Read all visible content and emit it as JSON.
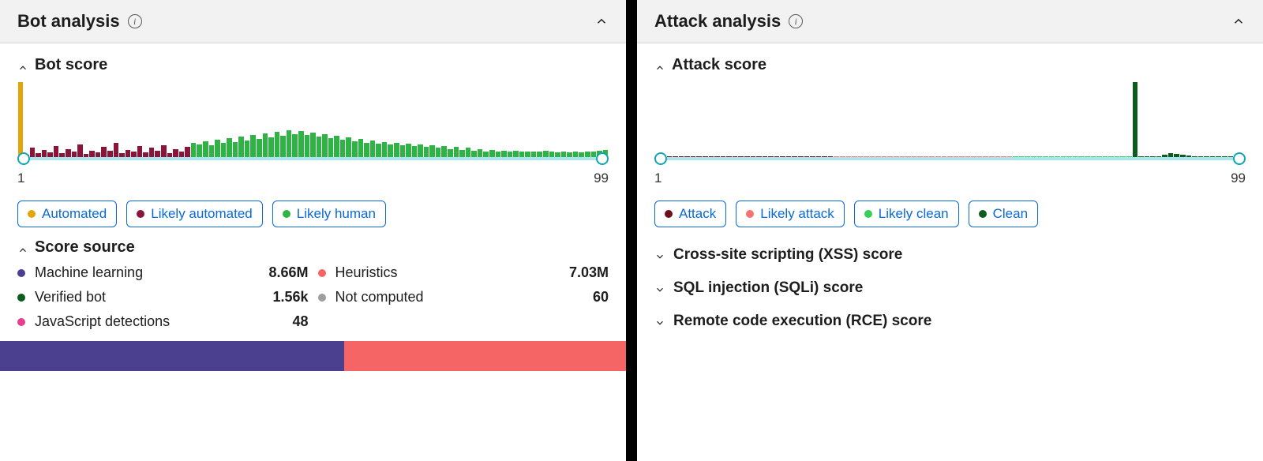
{
  "bot_panel": {
    "title": "Bot analysis",
    "score_section": "Bot score",
    "slider": {
      "min": "1",
      "max": "99"
    },
    "legend": [
      {
        "label": "Automated",
        "color": "#e5a50a"
      },
      {
        "label": "Likely automated",
        "color": "#8a1538"
      },
      {
        "label": "Likely human",
        "color": "#2fb344"
      }
    ],
    "source_section": "Score source",
    "sources": [
      {
        "label": "Machine learning",
        "value": "8.66M",
        "color": "#4b3f8f"
      },
      {
        "label": "Heuristics",
        "value": "7.03M",
        "color": "#f56565"
      },
      {
        "label": "Verified bot",
        "value": "1.56k",
        "color": "#0b5d1e"
      },
      {
        "label": "Not computed",
        "value": "60",
        "color": "#9e9e9e"
      },
      {
        "label": "JavaScript detections",
        "value": "48",
        "color": "#e83e8c"
      }
    ],
    "stack": [
      {
        "color": "#4b3f8f",
        "pct": 55
      },
      {
        "color": "#f56565",
        "pct": 45
      }
    ]
  },
  "attack_panel": {
    "title": "Attack analysis",
    "score_section": "Attack score",
    "slider": {
      "min": "1",
      "max": "99"
    },
    "legend": [
      {
        "label": "Attack",
        "color": "#6b0f1a"
      },
      {
        "label": "Likely attack",
        "color": "#f87171"
      },
      {
        "label": "Likely clean",
        "color": "#34d058"
      },
      {
        "label": "Clean",
        "color": "#0b5d1e"
      }
    ],
    "collapsed": [
      "Cross-site scripting (XSS) score",
      "SQL injection (SQLi) score",
      "Remote code execution (RCE) score"
    ]
  },
  "chart_data": [
    {
      "type": "bar",
      "title": "Bot score",
      "xlabel": "",
      "ylabel": "",
      "xlim": [
        1,
        99
      ],
      "series": [
        {
          "name": "Automated",
          "color": "#e5a50a",
          "x": [
            1
          ],
          "values": [
            92
          ]
        },
        {
          "name": "Likely automated",
          "color": "#8a1538",
          "x": [
            2,
            3,
            4,
            5,
            6,
            7,
            8,
            9,
            10,
            11,
            12,
            13,
            14,
            15,
            16,
            17,
            18,
            19,
            20,
            21,
            22,
            23,
            24,
            25,
            26,
            27,
            28,
            29
          ],
          "values": [
            4,
            12,
            6,
            10,
            7,
            14,
            6,
            11,
            8,
            16,
            5,
            9,
            7,
            13,
            9,
            18,
            6,
            10,
            8,
            14,
            7,
            12,
            9,
            15,
            6,
            11,
            8,
            13
          ]
        },
        {
          "name": "Likely human",
          "color": "#2fb344",
          "x": [
            30,
            31,
            32,
            33,
            34,
            35,
            36,
            37,
            38,
            39,
            40,
            41,
            42,
            43,
            44,
            45,
            46,
            47,
            48,
            49,
            50,
            51,
            52,
            53,
            54,
            55,
            56,
            57,
            58,
            59,
            60,
            61,
            62,
            63,
            64,
            65,
            66,
            67,
            68,
            69,
            70,
            71,
            72,
            73,
            74,
            75,
            76,
            77,
            78,
            79,
            80,
            81,
            82,
            83,
            84,
            85,
            86,
            87,
            88,
            89,
            90,
            91,
            92,
            93,
            94,
            95,
            96,
            97,
            98,
            99
          ],
          "values": [
            18,
            16,
            20,
            15,
            22,
            18,
            24,
            19,
            26,
            21,
            28,
            23,
            30,
            25,
            32,
            27,
            34,
            29,
            33,
            28,
            31,
            26,
            29,
            24,
            27,
            22,
            25,
            20,
            23,
            18,
            21,
            17,
            19,
            16,
            18,
            15,
            17,
            14,
            16,
            13,
            15,
            12,
            14,
            11,
            13,
            10,
            12,
            9,
            11,
            8,
            10,
            8,
            9,
            8,
            9,
            8,
            8,
            8,
            8,
            9,
            8,
            7,
            8,
            7,
            8,
            7,
            8,
            8,
            9,
            10
          ]
        }
      ]
    },
    {
      "type": "bar",
      "title": "Attack score",
      "xlabel": "",
      "ylabel": "",
      "xlim": [
        1,
        99
      ],
      "series": [
        {
          "name": "Attack",
          "color": "#6b0f1a",
          "x": [
            1,
            2,
            3,
            4,
            5,
            6,
            7,
            8,
            9,
            10,
            11,
            12,
            13,
            14,
            15,
            16,
            17,
            18,
            19,
            20,
            21,
            22,
            23,
            24,
            25,
            26,
            27,
            28,
            29,
            30
          ],
          "values": [
            2,
            2,
            2,
            2,
            2,
            2,
            2,
            2,
            2,
            2,
            2,
            2,
            2,
            2,
            2,
            2,
            2,
            2,
            2,
            2,
            2,
            2,
            2,
            2,
            2,
            2,
            2,
            2,
            2,
            2
          ]
        },
        {
          "name": "Likely attack",
          "color": "#f87171",
          "x": [
            31,
            32,
            33,
            34,
            35,
            36,
            37,
            38,
            39,
            40,
            41,
            42,
            43,
            44,
            45,
            46,
            47,
            48,
            49,
            50,
            51,
            52,
            53,
            54,
            55,
            56,
            57,
            58,
            59,
            60
          ],
          "values": [
            2,
            2,
            2,
            2,
            2,
            2,
            2,
            2,
            2,
            2,
            2,
            2,
            2,
            2,
            2,
            2,
            2,
            2,
            2,
            2,
            2,
            2,
            2,
            2,
            2,
            2,
            2,
            2,
            2,
            2
          ]
        },
        {
          "name": "Likely clean",
          "color": "#34d058",
          "x": [
            61,
            62,
            63,
            64,
            65,
            66,
            67,
            68,
            69,
            70,
            71,
            72,
            73,
            74,
            75,
            76,
            77,
            78,
            79,
            80
          ],
          "values": [
            2,
            2,
            2,
            2,
            2,
            2,
            2,
            2,
            2,
            2,
            2,
            2,
            2,
            2,
            2,
            2,
            2,
            2,
            2,
            2
          ]
        },
        {
          "name": "Clean",
          "color": "#0b5d1e",
          "x": [
            81,
            82,
            83,
            84,
            85,
            86,
            87,
            88,
            89,
            90,
            91,
            92,
            93,
            94,
            95,
            96,
            97,
            98,
            99
          ],
          "values": [
            92,
            2,
            2,
            2,
            2,
            4,
            6,
            5,
            4,
            3,
            2,
            2,
            2,
            2,
            2,
            2,
            2,
            2,
            2
          ]
        }
      ]
    }
  ]
}
